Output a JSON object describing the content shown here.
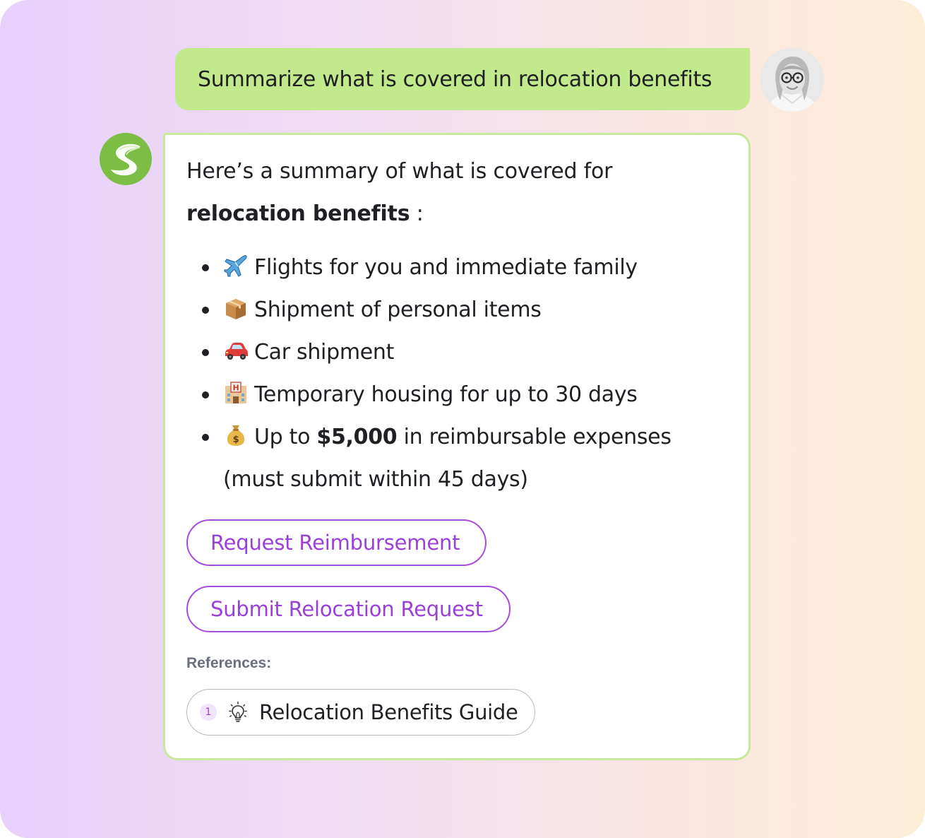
{
  "user_message": {
    "text": "Summarize what is covered in relocation benefits"
  },
  "assistant_message": {
    "intro_prefix": "Here’s a summary of what is covered for",
    "intro_bold": "relocation benefits",
    "intro_suffix": " :",
    "bullets": [
      {
        "icon": "airplane-icon",
        "text": "Flights for you and immediate family"
      },
      {
        "icon": "package-icon",
        "text": "Shipment of personal items"
      },
      {
        "icon": "car-icon",
        "text": "Car shipment"
      },
      {
        "icon": "hotel-icon",
        "text": "Temporary housing for up to 30 days"
      },
      {
        "icon": "money-bag-icon",
        "prefix": "Up to ",
        "bold": "$5,000",
        "suffix": " in reimbursable expenses",
        "continuation": "(must submit within 45 days)"
      }
    ],
    "actions": {
      "request_reimbursement": "Request Reimbursement",
      "submit_relocation_request": "Submit Relocation Request"
    },
    "references": {
      "label": "References:",
      "items": [
        {
          "number": "1",
          "icon": "lightbulb-icon",
          "title": "Relocation Benefits Guide"
        }
      ]
    }
  },
  "colors": {
    "user_bubble": "#c3e98d",
    "card_border": "#c9e99a",
    "accent_purple": "#9b3fd9",
    "bot_avatar_green": "#7bbd45"
  }
}
